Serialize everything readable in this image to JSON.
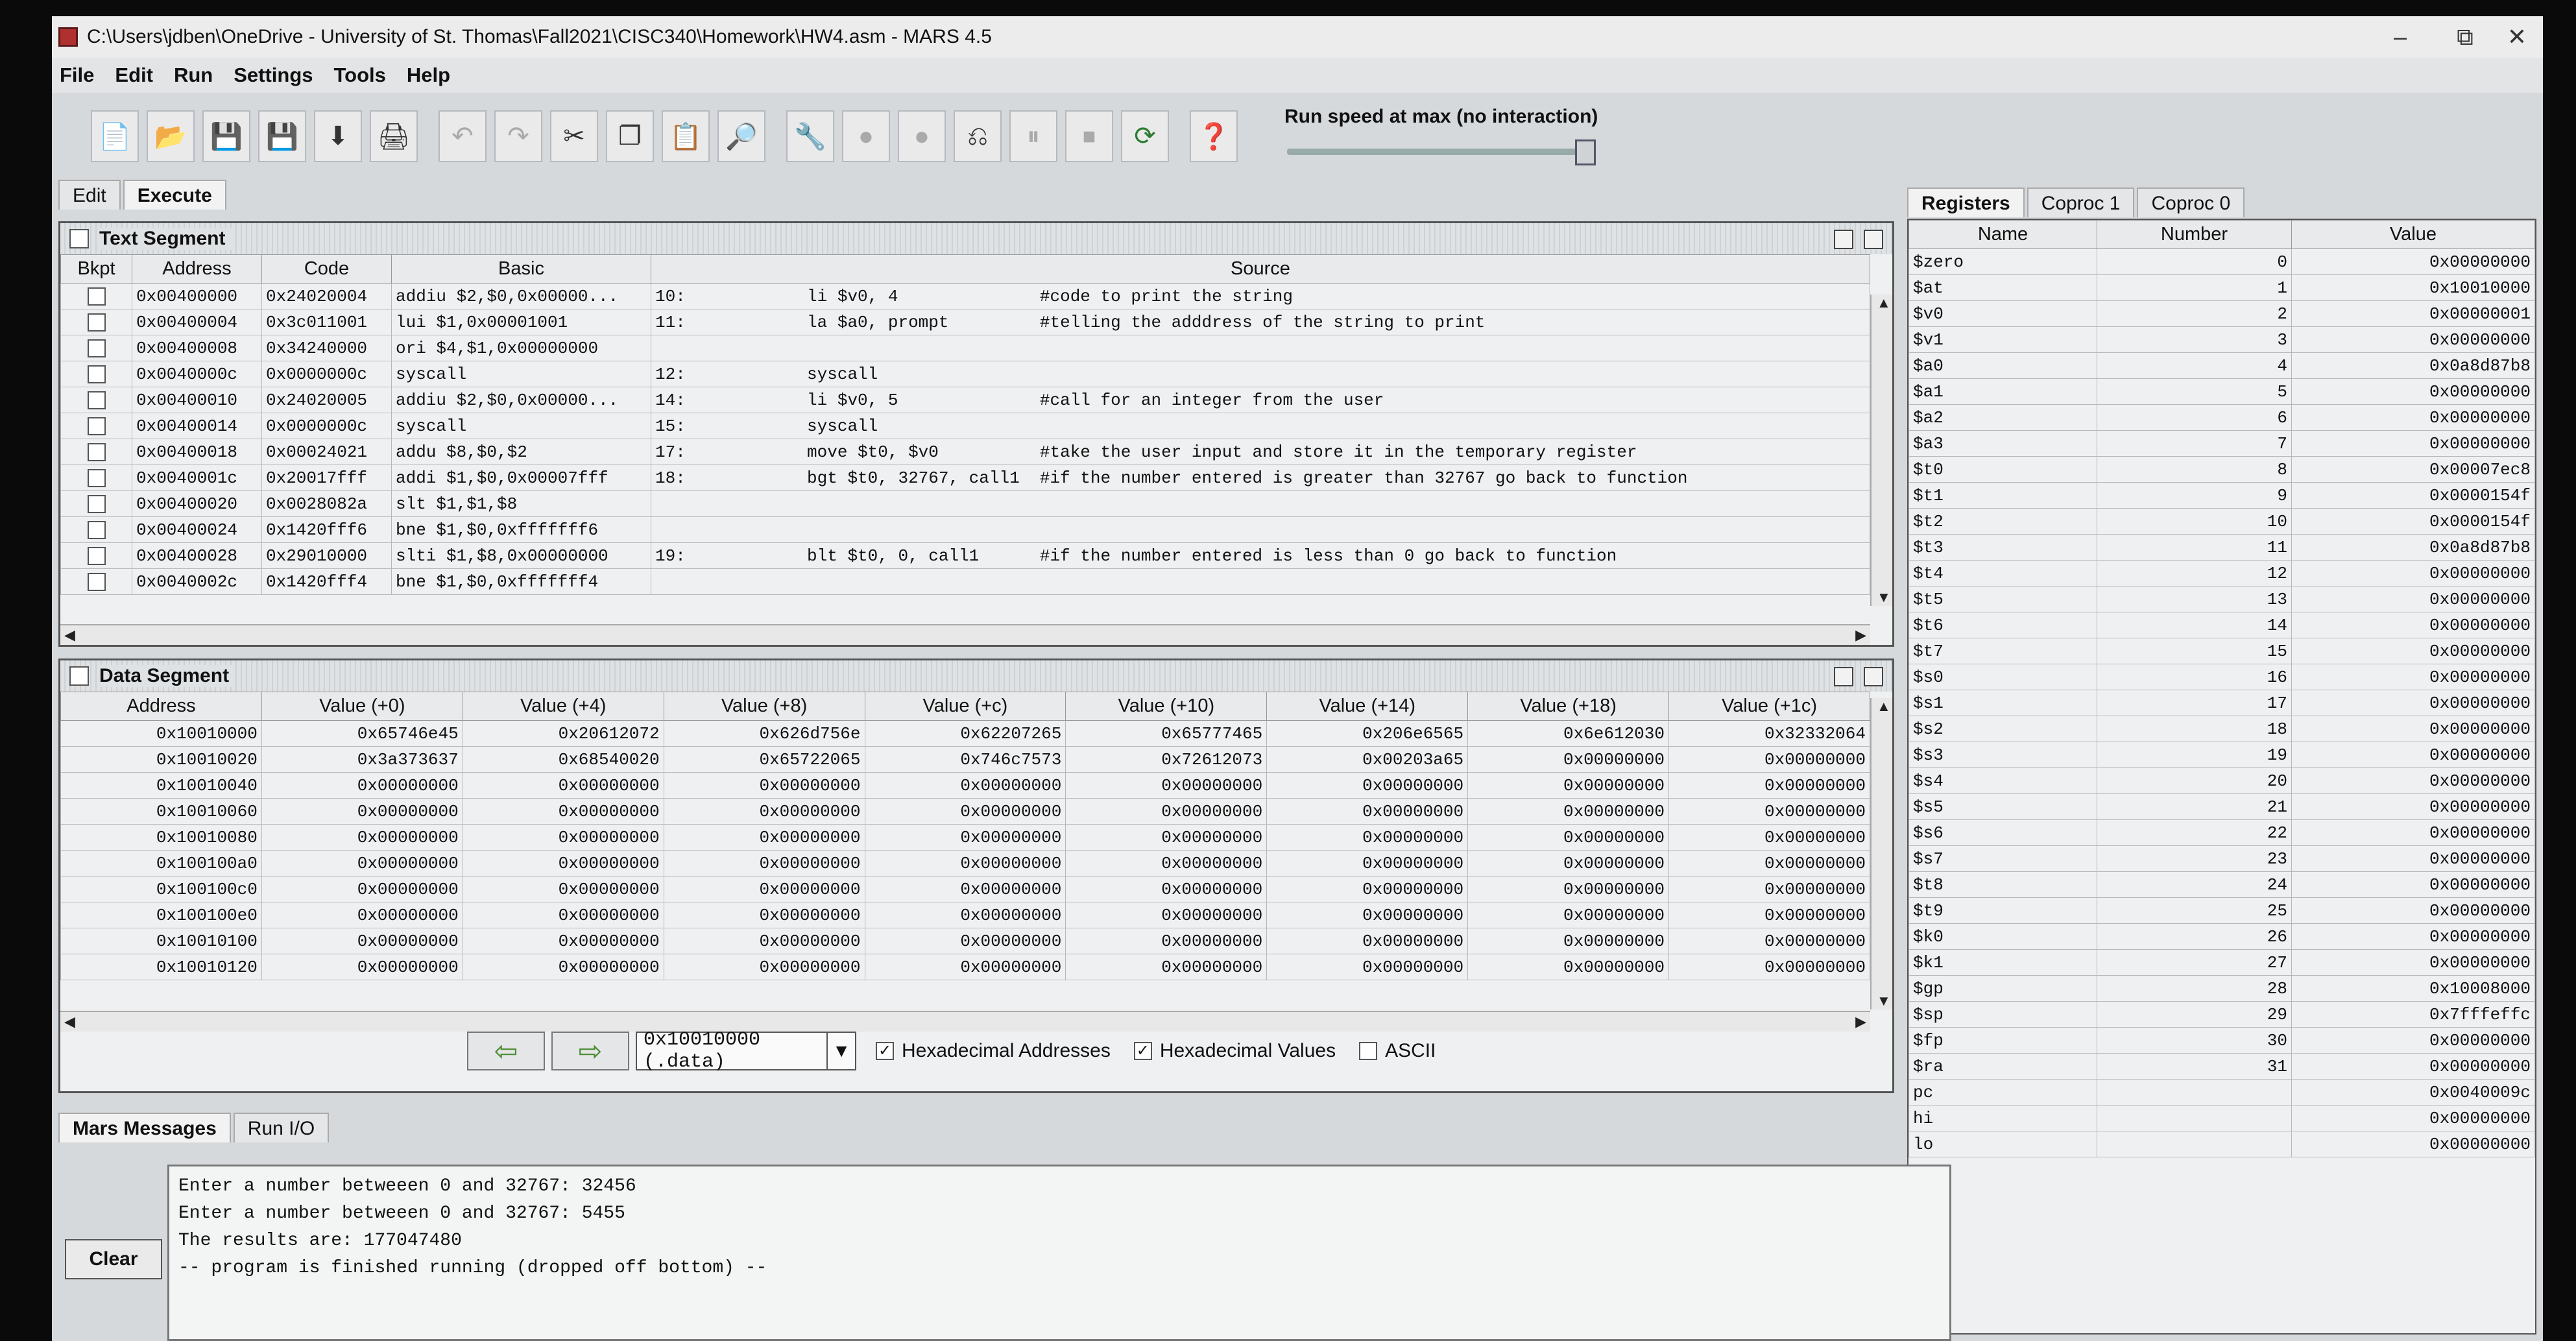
{
  "window": {
    "title": "C:\\Users\\jdben\\OneDrive - University of St. Thomas\\Fall2021\\CISC340\\Homework\\HW4.asm  - MARS 4.5",
    "minimize": "–",
    "maximize": "⧉",
    "close": "✕"
  },
  "menu": [
    "File",
    "Edit",
    "Run",
    "Settings",
    "Tools",
    "Help"
  ],
  "toolbar": {
    "icons": [
      "new-file-icon",
      "open-file-icon",
      "save-icon",
      "save-as-icon",
      "dump-memory-icon",
      "print-icon",
      "undo-icon",
      "redo-icon",
      "cut-icon",
      "copy-icon",
      "paste-icon",
      "find-replace-icon",
      "assemble-icon",
      "run-icon",
      "step-icon",
      "backstep-icon",
      "pause-icon",
      "stop-icon",
      "reset-icon",
      "help-icon"
    ],
    "speed_label": "Run speed at max (no interaction)"
  },
  "main_tabs": [
    "Edit",
    "Execute"
  ],
  "text_segment": {
    "title": "Text Segment",
    "headers": [
      "Bkpt",
      "Address",
      "Code",
      "Basic",
      "Source"
    ],
    "rows": [
      {
        "address": "0x00400000",
        "code": "0x24020004",
        "basic": "addiu $2,$0,0x00000...",
        "source": "10:            li $v0, 4              #code to print the string"
      },
      {
        "address": "0x00400004",
        "code": "0x3c011001",
        "basic": "lui $1,0x00001001",
        "source": "11:            la $a0, prompt         #telling the adddress of the string to print"
      },
      {
        "address": "0x00400008",
        "code": "0x34240000",
        "basic": "ori $4,$1,0x00000000",
        "source": ""
      },
      {
        "address": "0x0040000c",
        "code": "0x0000000c",
        "basic": "syscall",
        "source": "12:            syscall"
      },
      {
        "address": "0x00400010",
        "code": "0x24020005",
        "basic": "addiu $2,$0,0x00000...",
        "source": "14:            li $v0, 5              #call for an integer from the user"
      },
      {
        "address": "0x00400014",
        "code": "0x0000000c",
        "basic": "syscall",
        "source": "15:            syscall"
      },
      {
        "address": "0x00400018",
        "code": "0x00024021",
        "basic": "addu $8,$0,$2",
        "source": "17:            move $t0, $v0          #take the user input and store it in the temporary register"
      },
      {
        "address": "0x0040001c",
        "code": "0x20017fff",
        "basic": "addi $1,$0,0x00007fff",
        "source": "18:            bgt $t0, 32767, call1  #if the number entered is greater than 32767 go back to function"
      },
      {
        "address": "0x00400020",
        "code": "0x0028082a",
        "basic": "slt $1,$1,$8",
        "source": ""
      },
      {
        "address": "0x00400024",
        "code": "0x1420fff6",
        "basic": "bne $1,$0,0xfffffff6",
        "source": ""
      },
      {
        "address": "0x00400028",
        "code": "0x29010000",
        "basic": "slti $1,$8,0x00000000",
        "source": "19:            blt $t0, 0, call1      #if the number entered is less than 0 go back to function"
      },
      {
        "address": "0x0040002c",
        "code": "0x1420fff4",
        "basic": "bne $1,$0,0xfffffff4",
        "source": ""
      }
    ]
  },
  "data_segment": {
    "title": "Data Segment",
    "headers": [
      "Address",
      "Value (+0)",
      "Value (+4)",
      "Value (+8)",
      "Value (+c)",
      "Value (+10)",
      "Value (+14)",
      "Value (+18)",
      "Value (+1c)"
    ],
    "rows": [
      [
        "0x10010000",
        "0x65746e45",
        "0x20612072",
        "0x626d756e",
        "0x62207265",
        "0x65777465",
        "0x206e6565",
        "0x6e612030",
        "0x32332064"
      ],
      [
        "0x10010020",
        "0x3a373637",
        "0x68540020",
        "0x65722065",
        "0x746c7573",
        "0x72612073",
        "0x00203a65",
        "0x00000000",
        "0x00000000"
      ],
      [
        "0x10010040",
        "0x00000000",
        "0x00000000",
        "0x00000000",
        "0x00000000",
        "0x00000000",
        "0x00000000",
        "0x00000000",
        "0x00000000"
      ],
      [
        "0x10010060",
        "0x00000000",
        "0x00000000",
        "0x00000000",
        "0x00000000",
        "0x00000000",
        "0x00000000",
        "0x00000000",
        "0x00000000"
      ],
      [
        "0x10010080",
        "0x00000000",
        "0x00000000",
        "0x00000000",
        "0x00000000",
        "0x00000000",
        "0x00000000",
        "0x00000000",
        "0x00000000"
      ],
      [
        "0x100100a0",
        "0x00000000",
        "0x00000000",
        "0x00000000",
        "0x00000000",
        "0x00000000",
        "0x00000000",
        "0x00000000",
        "0x00000000"
      ],
      [
        "0x100100c0",
        "0x00000000",
        "0x00000000",
        "0x00000000",
        "0x00000000",
        "0x00000000",
        "0x00000000",
        "0x00000000",
        "0x00000000"
      ],
      [
        "0x100100e0",
        "0x00000000",
        "0x00000000",
        "0x00000000",
        "0x00000000",
        "0x00000000",
        "0x00000000",
        "0x00000000",
        "0x00000000"
      ],
      [
        "0x10010100",
        "0x00000000",
        "0x00000000",
        "0x00000000",
        "0x00000000",
        "0x00000000",
        "0x00000000",
        "0x00000000",
        "0x00000000"
      ],
      [
        "0x10010120",
        "0x00000000",
        "0x00000000",
        "0x00000000",
        "0x00000000",
        "0x00000000",
        "0x00000000",
        "0x00000000",
        "0x00000000"
      ]
    ],
    "address_select": "0x10010000 (.data)",
    "hex_addresses_label": "Hexadecimal Addresses",
    "hex_values_label": "Hexadecimal Values",
    "ascii_label": "ASCII",
    "hex_addresses_checked": true,
    "hex_values_checked": true,
    "ascii_checked": false
  },
  "registers": {
    "tabs": [
      "Registers",
      "Coproc 1",
      "Coproc 0"
    ],
    "headers": [
      "Name",
      "Number",
      "Value"
    ],
    "rows": [
      [
        "$zero",
        "0",
        "0x00000000"
      ],
      [
        "$at",
        "1",
        "0x10010000"
      ],
      [
        "$v0",
        "2",
        "0x00000001"
      ],
      [
        "$v1",
        "3",
        "0x00000000"
      ],
      [
        "$a0",
        "4",
        "0x0a8d87b8"
      ],
      [
        "$a1",
        "5",
        "0x00000000"
      ],
      [
        "$a2",
        "6",
        "0x00000000"
      ],
      [
        "$a3",
        "7",
        "0x00000000"
      ],
      [
        "$t0",
        "8",
        "0x00007ec8"
      ],
      [
        "$t1",
        "9",
        "0x0000154f"
      ],
      [
        "$t2",
        "10",
        "0x0000154f"
      ],
      [
        "$t3",
        "11",
        "0x0a8d87b8"
      ],
      [
        "$t4",
        "12",
        "0x00000000"
      ],
      [
        "$t5",
        "13",
        "0x00000000"
      ],
      [
        "$t6",
        "14",
        "0x00000000"
      ],
      [
        "$t7",
        "15",
        "0x00000000"
      ],
      [
        "$s0",
        "16",
        "0x00000000"
      ],
      [
        "$s1",
        "17",
        "0x00000000"
      ],
      [
        "$s2",
        "18",
        "0x00000000"
      ],
      [
        "$s3",
        "19",
        "0x00000000"
      ],
      [
        "$s4",
        "20",
        "0x00000000"
      ],
      [
        "$s5",
        "21",
        "0x00000000"
      ],
      [
        "$s6",
        "22",
        "0x00000000"
      ],
      [
        "$s7",
        "23",
        "0x00000000"
      ],
      [
        "$t8",
        "24",
        "0x00000000"
      ],
      [
        "$t9",
        "25",
        "0x00000000"
      ],
      [
        "$k0",
        "26",
        "0x00000000"
      ],
      [
        "$k1",
        "27",
        "0x00000000"
      ],
      [
        "$gp",
        "28",
        "0x10008000"
      ],
      [
        "$sp",
        "29",
        "0x7fffeffc"
      ],
      [
        "$fp",
        "30",
        "0x00000000"
      ],
      [
        "$ra",
        "31",
        "0x00000000"
      ],
      [
        "pc",
        "",
        "0x0040009c"
      ],
      [
        "hi",
        "",
        "0x00000000"
      ],
      [
        "lo",
        "",
        "0x00000000"
      ]
    ]
  },
  "messages": {
    "tabs": [
      "Mars Messages",
      "Run I/O"
    ],
    "clear_label": "Clear",
    "lines": [
      "Enter a number betweeen 0 and 32767: 32456",
      "Enter a number betweeen 0 and 32767: 5455",
      "The results are: 177047480",
      "-- program is finished running (dropped off bottom) --"
    ]
  }
}
